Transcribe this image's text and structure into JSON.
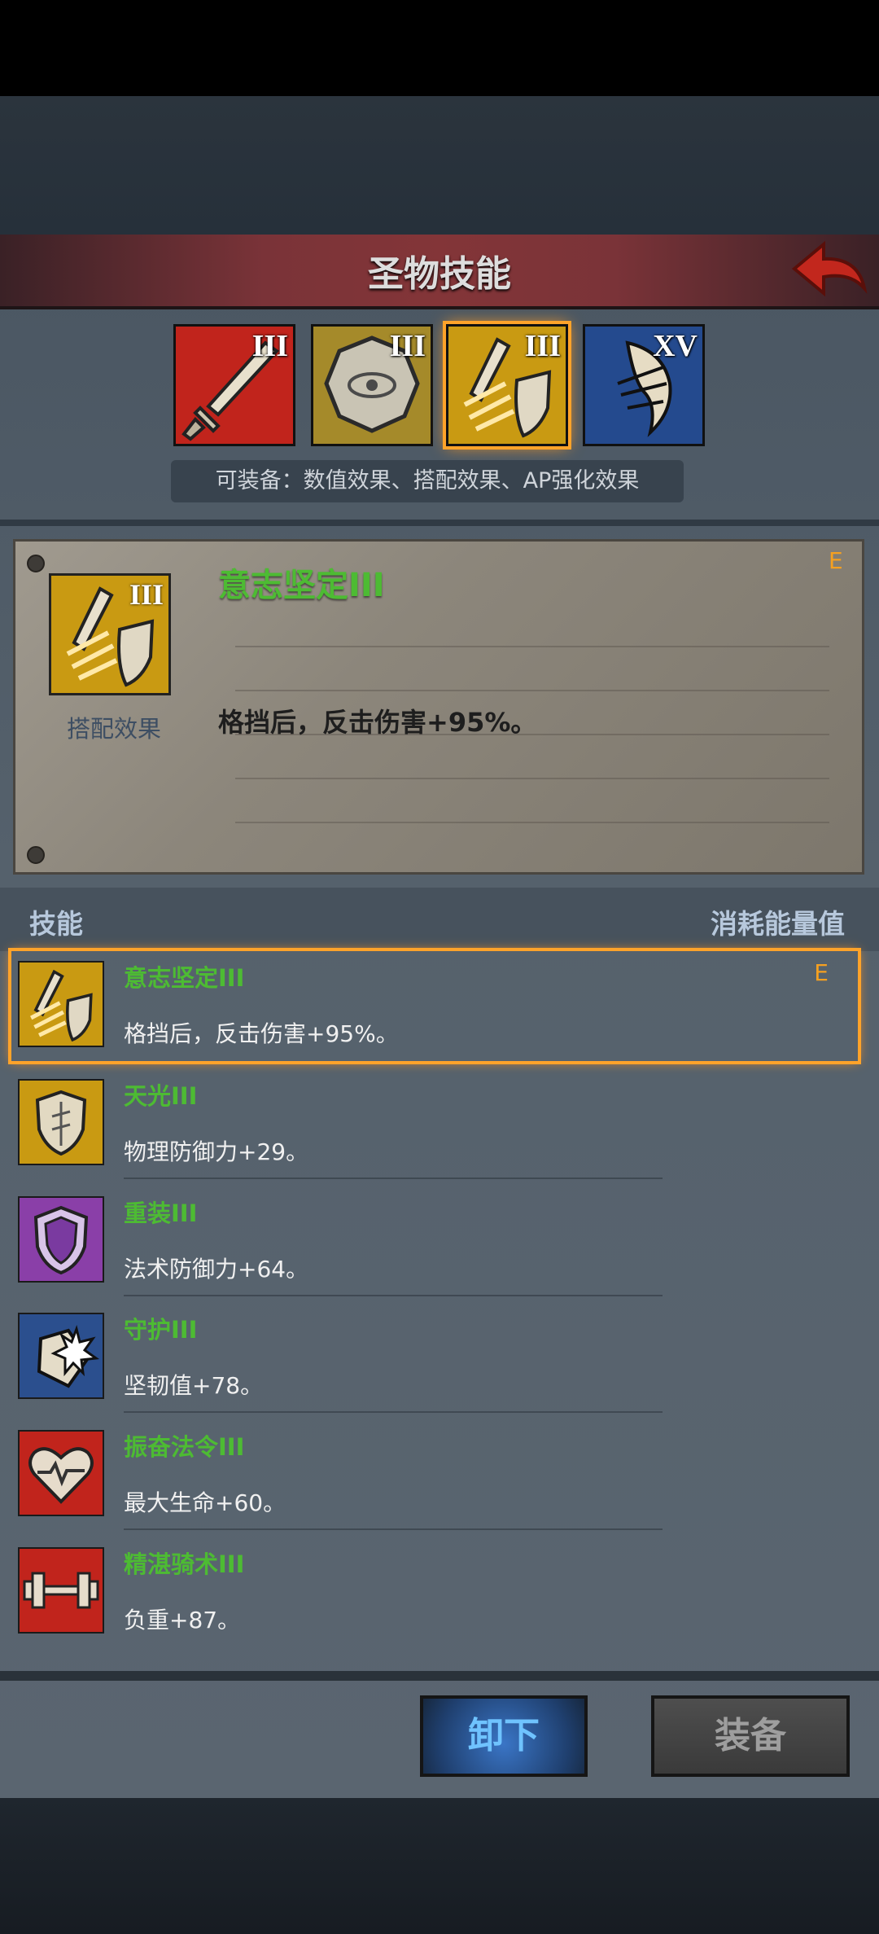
{
  "header": {
    "title": "圣物技能"
  },
  "relics": [
    {
      "name": "sword-relic",
      "tier": "III",
      "color": "#c1241c"
    },
    {
      "name": "seal-relic",
      "tier": "III",
      "color": "#a58a2a"
    },
    {
      "name": "sword-shield-relic",
      "tier": "III",
      "color": "#c99a12",
      "selected": true
    },
    {
      "name": "wing-relic",
      "tier": "XV",
      "color": "#244a8e"
    }
  ],
  "hint": "可装备：数值效果、搭配效果、AP强化效果",
  "detail": {
    "name": "意志坚定III",
    "type": "搭配效果",
    "desc": "格挡后，反击伤害+95%。",
    "badge": "E",
    "tier": "III"
  },
  "list_header": {
    "left": "技能",
    "right": "消耗能量值"
  },
  "skills": [
    {
      "name": "意志坚定III",
      "desc": "格挡后，反击伤害+95%。",
      "badge": "E",
      "icon": "sword-shield-icon",
      "bg": "#c99a12",
      "selected": true
    },
    {
      "name": "天光III",
      "desc": "物理防御力+29。",
      "badge": "",
      "icon": "shield-icon",
      "bg": "#c99a12"
    },
    {
      "name": "重装III",
      "desc": "法术防御力+64。",
      "badge": "",
      "icon": "purple-shield-icon",
      "bg": "#8a3fa8"
    },
    {
      "name": "守护III",
      "desc": "坚韧值+78。",
      "badge": "",
      "icon": "burst-shield-icon",
      "bg": "#2b4f8e"
    },
    {
      "name": "振奋法令III",
      "desc": "最大生命+60。",
      "badge": "",
      "icon": "heart-icon",
      "bg": "#c1241c"
    },
    {
      "name": "精湛骑术III",
      "desc": "负重+87。",
      "badge": "",
      "icon": "dumbbell-icon",
      "bg": "#c1241c"
    }
  ],
  "buttons": {
    "unequip": "卸下",
    "equip": "装备"
  }
}
